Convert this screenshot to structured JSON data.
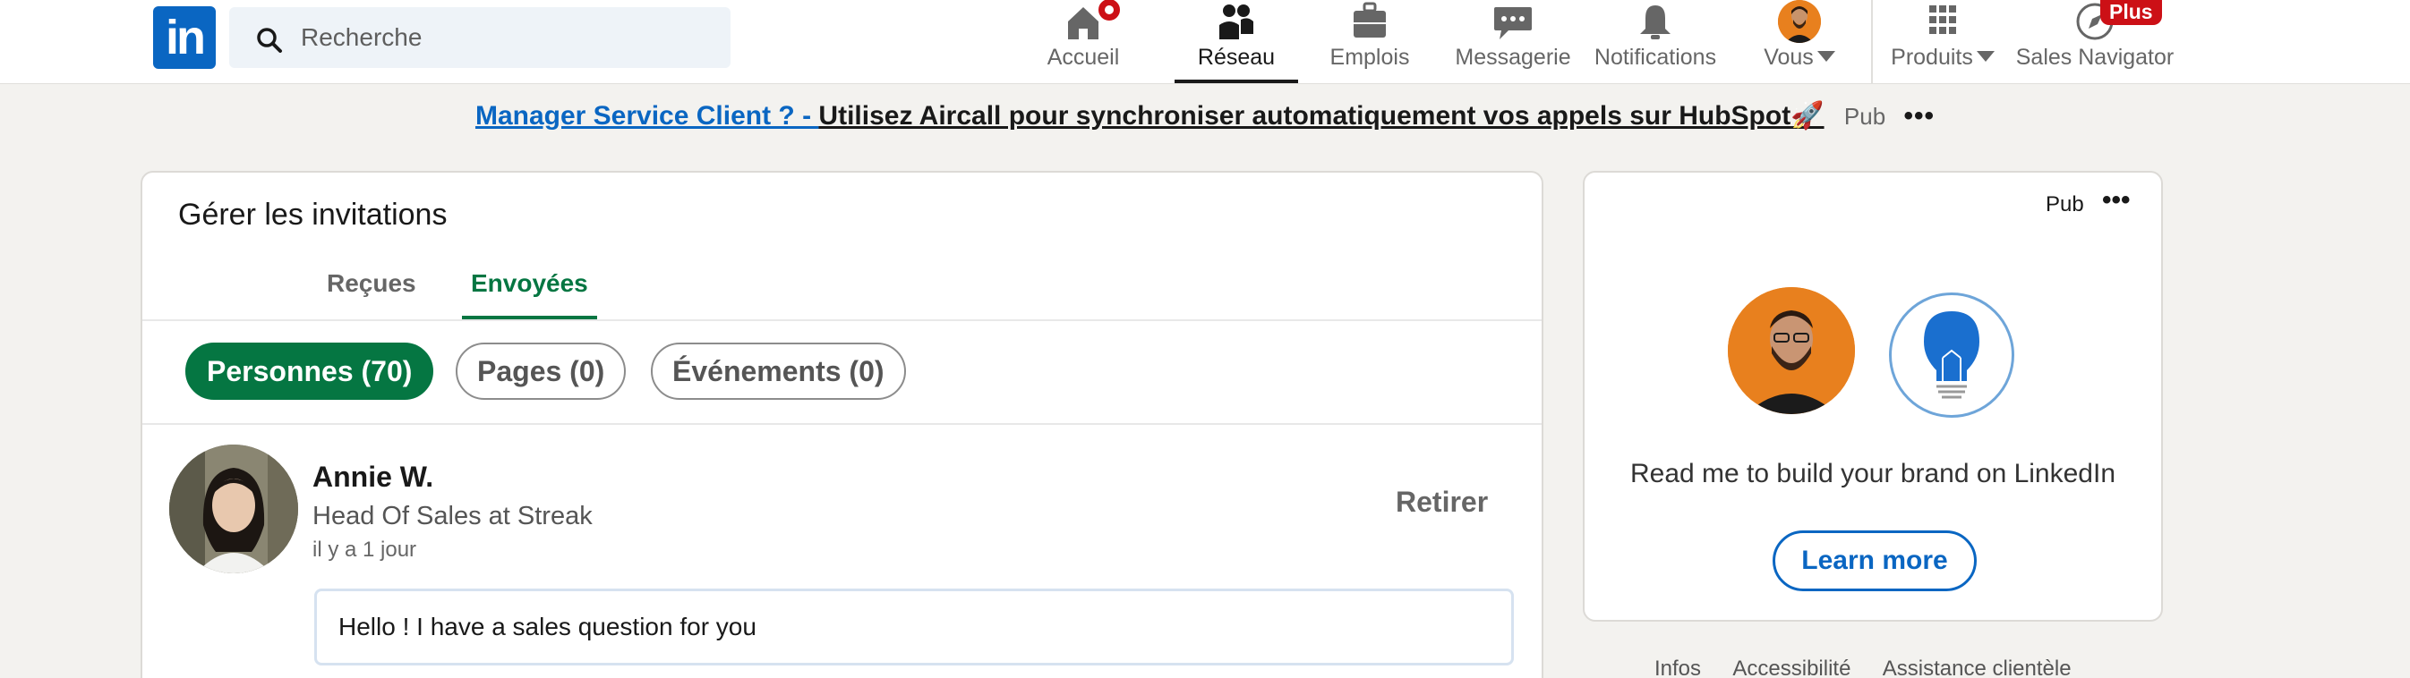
{
  "nav": {
    "logo_text": "in",
    "search_placeholder": "Recherche",
    "items": [
      {
        "label": "Accueil",
        "icon": "home-icon"
      },
      {
        "label": "Réseau",
        "icon": "people-icon",
        "active": true
      },
      {
        "label": "Emplois",
        "icon": "briefcase-icon"
      },
      {
        "label": "Messagerie",
        "icon": "chat-icon"
      },
      {
        "label": "Notifications",
        "icon": "bell-icon"
      },
      {
        "label": "Vous",
        "icon": "avatar"
      },
      {
        "label": "Produits",
        "icon": "grid-icon"
      },
      {
        "label": "Sales Navigator",
        "icon": "compass-icon"
      }
    ],
    "plus_badge": "Plus"
  },
  "banner": {
    "link_text": "Manager Service Client ? - ",
    "rest_text": "Utilisez Aircall pour synchroniser automatiquement vos appels sur HubSpot🚀",
    "pub": "Pub",
    "more": "•••"
  },
  "invitations": {
    "title": "Gérer les invitations",
    "tabs": [
      "Reçues",
      "Envoyées"
    ],
    "active_tab": "Envoyées",
    "filters": [
      "Personnes (70)",
      "Pages (0)",
      "Événements (0)"
    ],
    "active_filter": "Personnes (70)",
    "entries": [
      {
        "name": "Annie W.",
        "headline": "Head Of Sales at Streak",
        "time": "il y a 1 jour",
        "action": "Retirer",
        "message": "Hello ! I have a sales question for you"
      }
    ]
  },
  "side_ad": {
    "pub": "Pub",
    "more": "•••",
    "text": "Read me to build your brand on LinkedIn",
    "button": "Learn more"
  },
  "footer": {
    "links": [
      "Infos",
      "Accessibilité",
      "Assistance clientèle"
    ]
  },
  "colors": {
    "brand": "#0a66c2",
    "accent_green": "#057642",
    "badge_red": "#cc1016",
    "background": "#f3f2ef"
  }
}
